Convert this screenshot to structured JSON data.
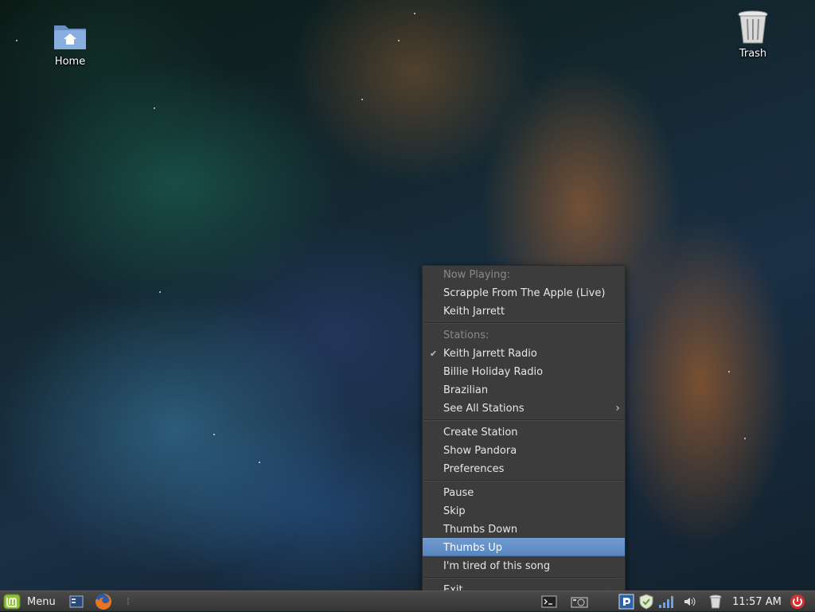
{
  "desktop": {
    "icons": [
      {
        "label": "Home",
        "icon": "home-folder-icon"
      },
      {
        "label": "Trash",
        "icon": "trash-icon"
      }
    ]
  },
  "pandora_menu": {
    "now_playing_header": "Now Playing:",
    "song_title": "Scrapple From The Apple (Live)",
    "artist": "Keith Jarrett",
    "stations_header": "Stations:",
    "stations": [
      {
        "label": "Keith Jarrett Radio",
        "checked": true
      },
      {
        "label": "Billie Holiday Radio",
        "checked": false
      },
      {
        "label": "Brazilian",
        "checked": false
      }
    ],
    "see_all_stations": "See All Stations",
    "create_station": "Create Station",
    "show_pandora": "Show Pandora",
    "preferences": "Preferences",
    "pause": "Pause",
    "skip": "Skip",
    "thumbs_down": "Thumbs Down",
    "thumbs_up": "Thumbs Up",
    "tired": "I'm tired of this song",
    "exit": "Exit",
    "highlighted_item": "Thumbs Up"
  },
  "panel": {
    "menu_label": "Menu",
    "clock": "11:57 AM",
    "launchers": [
      "show-desktop-icon",
      "firefox-icon"
    ],
    "tray": [
      "terminal-icon",
      "screenshot-icon",
      "pandora-icon",
      "shield-icon",
      "network-signal-icon",
      "volume-icon",
      "trash-icon",
      "power-icon"
    ]
  },
  "colors": {
    "menu_bg": "#3c3c3c",
    "highlight": "#6a94cc",
    "panel_bg": "#3f3f3f",
    "mint_green": "#8fc03a",
    "power_red": "#d83030"
  }
}
